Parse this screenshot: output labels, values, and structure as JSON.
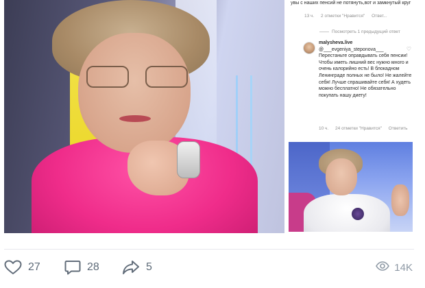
{
  "comments_panel": {
    "previous_comment": {
      "text": "увы с наших пенсий не потянуть,вот и замкнутый круг",
      "time": "13 ч.",
      "likes": "2 отметки \"Нравится\"",
      "reply_label": "Ответ..."
    },
    "view_replies": "Посмотреть 1 предыдущий ответ",
    "reply": {
      "username": "malysheva.live",
      "text": "@___evgeniya_steponova___ Перестаньте оправдывать себя пенсии! Чтобы иметь лишний вес нужно много и очень калорийно есть! В блокадном Ленинграде полных не было! Не жалейте себя! Лучше спрашивайте себя! А худеть можно бесплатно! Не обязательно покупать нашу диету!",
      "time": "10 ч.",
      "likes": "24 отметки \"Нравится\"",
      "reply_label": "Ответить"
    }
  },
  "actions": {
    "likes": "27",
    "comments": "28",
    "shares": "5",
    "views": "14K"
  },
  "icons": {
    "like": "heart-icon",
    "comment": "comment-icon",
    "share": "share-arrow-icon",
    "views": "eye-icon"
  },
  "colors": {
    "icon": "#626d7a",
    "views": "#8e99a5",
    "divider": "#e7e8ec"
  }
}
